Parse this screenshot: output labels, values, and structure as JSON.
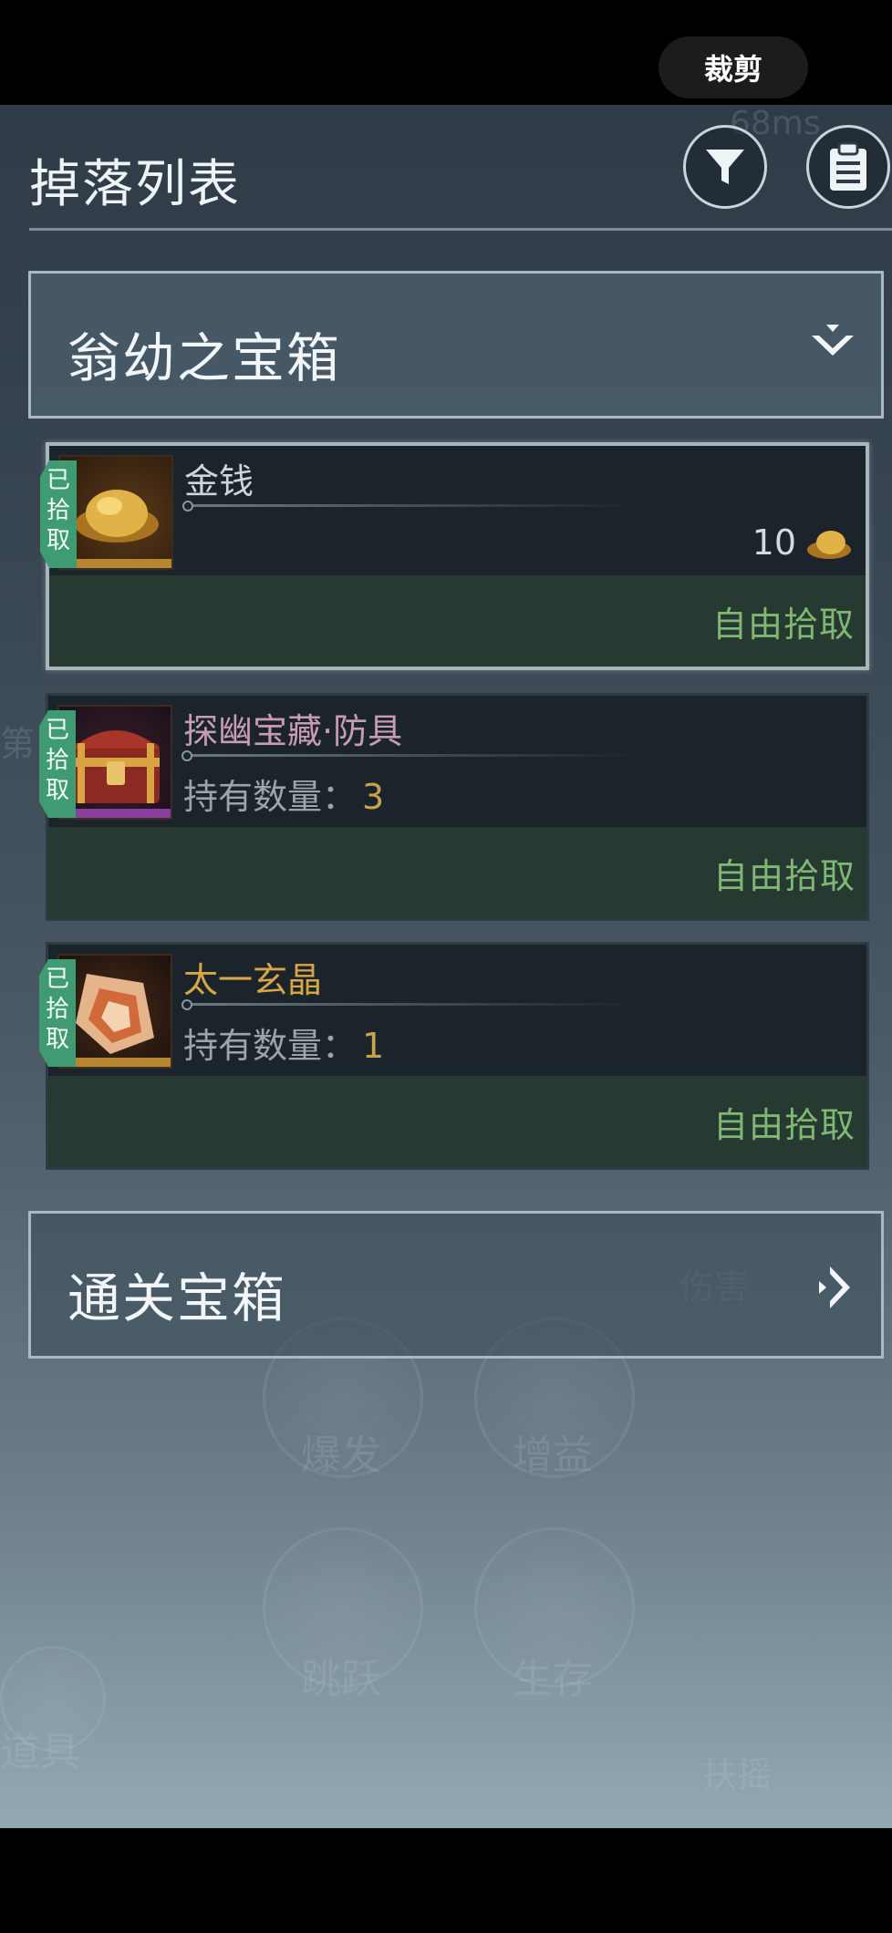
{
  "system": {
    "crop_label": "裁剪"
  },
  "header": {
    "title": "掉落列表",
    "filter_icon": "filter-icon",
    "clipboard_icon": "clipboard-icon"
  },
  "sections": [
    {
      "label": "翁幼之宝箱",
      "state": "expanded",
      "items": [
        {
          "name": "金钱",
          "name_color": "#cfd6da",
          "picked_tag": "已\n拾\n取",
          "quantity": "10",
          "action": "自由拾取",
          "rarity_color": "#b8862e",
          "selected": true
        },
        {
          "name": "探幽宝藏·防具",
          "name_color": "#c89bb6",
          "picked_tag": "已\n拾\n取",
          "owned_label": "持有数量：",
          "owned_count": "3",
          "action": "自由拾取",
          "rarity_color": "#8a3fa0",
          "selected": false
        },
        {
          "name": "太一玄晶",
          "name_color": "#d7a646",
          "picked_tag": "已\n拾\n取",
          "owned_label": "持有数量：",
          "owned_count": "1",
          "action": "自由拾取",
          "rarity_color": "#b8862e",
          "selected": false
        }
      ]
    },
    {
      "label": "通关宝箱",
      "state": "collapsed"
    }
  ],
  "background_labels": [
    "爆发",
    "增益",
    "跳跃",
    "生存",
    "道具",
    "扶摇",
    "伤害",
    "68ms",
    "第"
  ]
}
